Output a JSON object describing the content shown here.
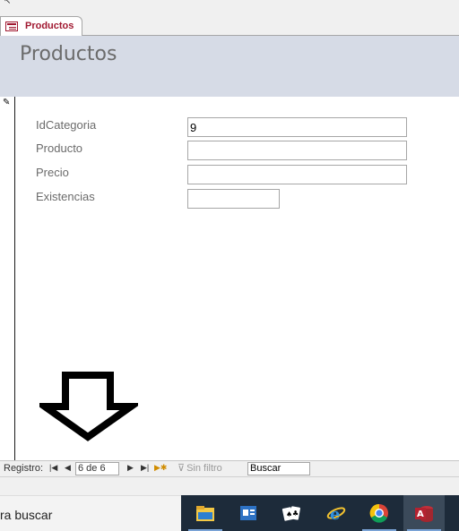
{
  "window": {
    "tab_label": "Productos"
  },
  "header": {
    "title": "Productos"
  },
  "form": {
    "fields": [
      {
        "label": "IdCategoria",
        "value": "9"
      },
      {
        "label": "Producto",
        "value": ""
      },
      {
        "label": "Precio",
        "value": ""
      },
      {
        "label": "Existencias",
        "value": ""
      }
    ]
  },
  "navigation": {
    "label": "Registro:",
    "record_position": "6 de 6",
    "filter_label": "Sin filtro",
    "search_value": "Buscar"
  },
  "taskbar": {
    "search_text": "ra buscar",
    "apps": [
      "file-explorer",
      "outlook",
      "solitaire",
      "internet-explorer",
      "chrome",
      "access"
    ]
  },
  "colors": {
    "accent": "#a01830",
    "header_bg": "#d6dbe6",
    "taskbar_bg": "#1d2b3a"
  }
}
